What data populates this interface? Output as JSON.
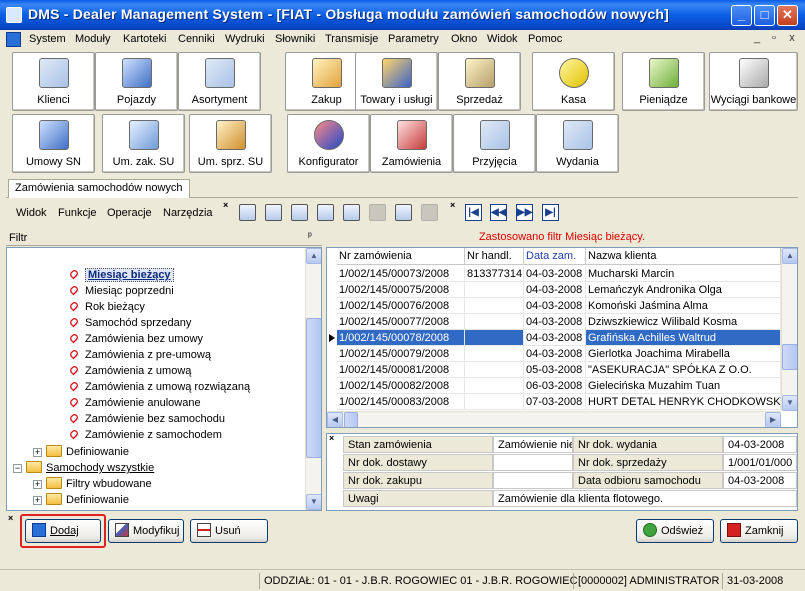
{
  "window": {
    "title": "DMS - Dealer Management System - [FIAT - Obsługa modułu zamówień samochodów nowych]",
    "min": "_",
    "max": "□",
    "close": "✕"
  },
  "menu": [
    "System",
    "Moduły",
    "Kartoteki",
    "Cenniki",
    "Wydruki",
    "Słowniki",
    "Transmisje",
    "Parametry",
    "Okno",
    "Widok",
    "Pomoc"
  ],
  "mdi_controls": [
    "_",
    "▫",
    "x"
  ],
  "toolbar_row1": [
    {
      "label": "Klienci",
      "icon": "clients-icon"
    },
    {
      "label": "Pojazdy",
      "icon": "car-icon"
    },
    {
      "label": "Asortyment",
      "icon": "list-icon"
    },
    {
      "label": "Zakup",
      "icon": "purchase-icon"
    },
    {
      "label": "Towary i usługi",
      "icon": "goods-icon"
    },
    {
      "label": "Sprzedaż",
      "icon": "sales-icon"
    },
    {
      "label": "Kasa",
      "icon": "coins-icon"
    },
    {
      "label": "Pieniądze",
      "icon": "money-icon"
    },
    {
      "label": "Wyciągi bankowe",
      "icon": "bank-statement-icon"
    }
  ],
  "toolbar_row2": [
    {
      "label": "Umowy SN",
      "icon": "contracts-icon"
    },
    {
      "label": "Um. zak. SU",
      "icon": "purchase-contract-icon"
    },
    {
      "label": "Um. sprz. SU",
      "icon": "sale-contract-icon"
    },
    {
      "label": "Konfigurator",
      "icon": "configurator-icon"
    },
    {
      "label": "Zamówienia",
      "icon": "orders-icon"
    },
    {
      "label": "Przyjęcia",
      "icon": "receipts-icon"
    },
    {
      "label": "Wydania",
      "icon": "issues-icon"
    }
  ],
  "tab": {
    "label": "Zamówienia samochodów nowych"
  },
  "secondary_menu": [
    "Widok",
    "Funkcje",
    "Operacje",
    "Narzędzia"
  ],
  "close_mark": "×",
  "nav_buttons": [
    "|◀",
    "◀◀",
    "▶▶",
    "▶|"
  ],
  "filter_panel": {
    "title": "Filtr",
    "pin": "ᵖ",
    "items": [
      {
        "label": "Miesiąc bieżący",
        "type": "filter",
        "selected": true
      },
      {
        "label": "Miesiąc poprzedni",
        "type": "filter"
      },
      {
        "label": "Rok bieżący",
        "type": "filter"
      },
      {
        "label": "Samochód sprzedany",
        "type": "filter"
      },
      {
        "label": "Zamówienia bez umowy",
        "type": "filter"
      },
      {
        "label": "Zamówienia z pre-umową",
        "type": "filter"
      },
      {
        "label": "Zamówienia z umową",
        "type": "filter"
      },
      {
        "label": "Zamówienia z umową rozwiązaną",
        "type": "filter"
      },
      {
        "label": "Zamówienie anulowane",
        "type": "filter"
      },
      {
        "label": "Zamówienie bez samochodu",
        "type": "filter"
      },
      {
        "label": "Zamówienie z samochodem",
        "type": "filter"
      },
      {
        "label": "Definiowanie",
        "type": "folder",
        "exp": "+"
      },
      {
        "label": "Samochody wszystkie",
        "type": "folder",
        "exp": "−",
        "root": true
      },
      {
        "label": "Filtry wbudowane",
        "type": "folder",
        "exp": "+"
      },
      {
        "label": "Definiowanie",
        "type": "folder",
        "exp": "+"
      }
    ]
  },
  "grid": {
    "filter_info": "Zastosowano filtr Miesiąc bieżący.",
    "columns": [
      "Nr zamówienia",
      "Nr handl.",
      "Data zam.",
      "Nazwa klienta"
    ],
    "rows": [
      [
        "1/002/145/00073/2008",
        "813377314",
        "04-03-2008",
        "Mucharski Marcin"
      ],
      [
        "1/002/145/00075/2008",
        "",
        "04-03-2008",
        "Lemańczyk Andronika Olga"
      ],
      [
        "1/002/145/00076/2008",
        "",
        "04-03-2008",
        "Komoński Jaśmina Alma"
      ],
      [
        "1/002/145/00077/2008",
        "",
        "04-03-2008",
        "Dziwszkiewicz Wilibald Kosma"
      ],
      [
        "1/002/145/00078/2008",
        "",
        "04-03-2008",
        "Grafińska Achilles Waltrud"
      ],
      [
        "1/002/145/00079/2008",
        "",
        "04-03-2008",
        "Gierlotka Joachima Mirabella"
      ],
      [
        "1/002/145/00081/2008",
        "",
        "05-03-2008",
        "\"ASEKURACJA\" SPÓŁKA Z O.O."
      ],
      [
        "1/002/145/00082/2008",
        "",
        "06-03-2008",
        "Gielecińska Muzahim Tuan"
      ],
      [
        "1/002/145/00083/2008",
        "",
        "07-03-2008",
        "HURT DETAL HENRYK CHODKOWSKI"
      ]
    ],
    "selected_row": 4
  },
  "details": {
    "rows": [
      [
        "Stan zamówienia",
        "Zamówienie niep",
        "Nr dok. wydania",
        "04-03-2008"
      ],
      [
        "Nr dok. dostawy",
        "",
        "Nr dok. sprzedaży",
        "1/001/01/000"
      ],
      [
        "Nr dok. zakupu",
        "",
        "Data odbioru samochodu",
        "04-03-2008"
      ]
    ],
    "notes_label": "Uwagi",
    "notes_value": "Zamówienie dla klienta flotowego."
  },
  "buttons": {
    "add": "Dodaj",
    "modify": "Modyfikuj",
    "delete": "Usuń",
    "refresh": "Odśwież",
    "close": "Zamknij"
  },
  "status": {
    "branch": "ODDZIAŁ: 01 - 01 - J.B.R. ROGOWIEC 01 - J.B.R. ROGOWIEC",
    "user": "[0000002] ADMINISTRATOR",
    "date": "31-03-2008"
  },
  "colors": {
    "selection": "#316ac5",
    "filter_info": "#e00000",
    "highlight_border": "#e12020"
  }
}
